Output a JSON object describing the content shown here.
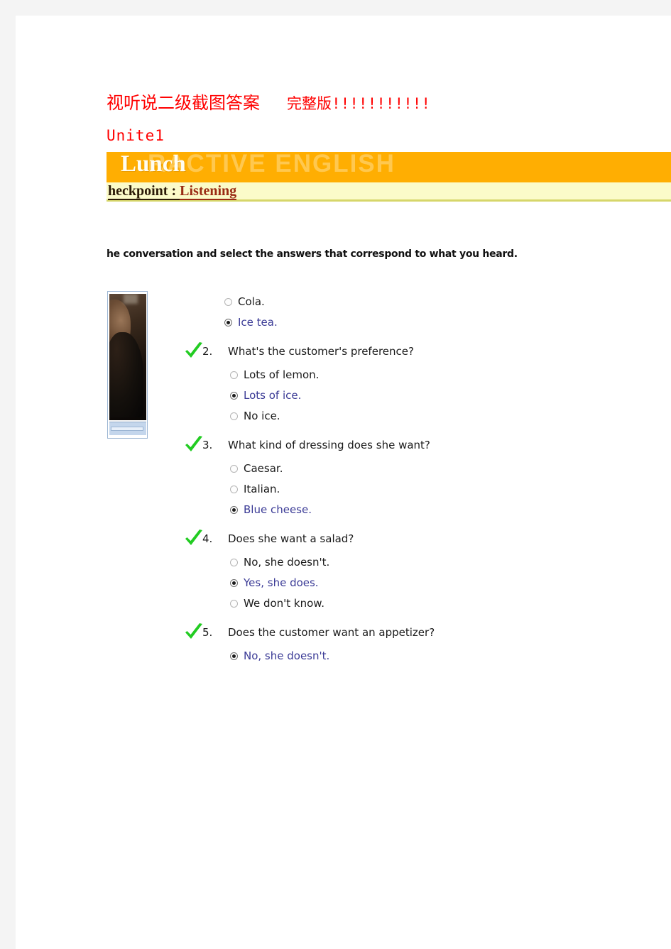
{
  "document": {
    "title_cn": "视听说二级截图答案",
    "title_bangs": "完整版!!!!!!!!!!!",
    "unit_label": "Unite1"
  },
  "screenshot": {
    "banner": {
      "title": "Lunch",
      "watermark": "RACTIVE ENGLISH",
      "bg_color": "#ffae02",
      "title_color": "#fffdf2"
    },
    "subbar": {
      "lead": "heckpoint",
      "separator": " : ",
      "accent": "Listening",
      "bg_color": "#fbfbc9",
      "accent_color": "#9a2b14"
    },
    "instructions": "he conversation and select the answers that correspond to what you heard.",
    "media": {
      "name": "video-thumbnail",
      "frame_color": "#9db6d4"
    }
  },
  "quiz": {
    "check_color": "#22cc22",
    "selected_color": "#3b3b96",
    "questions": [
      {
        "number": "",
        "text": "",
        "has_check": false,
        "indent": true,
        "options": [
          {
            "label": "Cola.",
            "selected": false
          },
          {
            "label": "Ice tea.",
            "selected": true
          }
        ]
      },
      {
        "number": "2.",
        "text": "What's the customer's preference?",
        "has_check": true,
        "indent": false,
        "options": [
          {
            "label": "Lots of lemon.",
            "selected": false
          },
          {
            "label": "Lots of ice.",
            "selected": true
          },
          {
            "label": "No ice.",
            "selected": false
          }
        ]
      },
      {
        "number": "3.",
        "text": "What kind of dressing does she want?",
        "has_check": true,
        "indent": false,
        "options": [
          {
            "label": "Caesar.",
            "selected": false
          },
          {
            "label": "Italian.",
            "selected": false
          },
          {
            "label": "Blue cheese.",
            "selected": true
          }
        ]
      },
      {
        "number": "4.",
        "text": "Does she want a salad?",
        "has_check": true,
        "indent": false,
        "options": [
          {
            "label": "No, she doesn't.",
            "selected": false
          },
          {
            "label": "Yes, she does.",
            "selected": true
          },
          {
            "label": "We don't know.",
            "selected": false
          }
        ]
      },
      {
        "number": "5.",
        "text": "Does the customer want an appetizer?",
        "has_check": true,
        "indent": false,
        "options": [
          {
            "label": "No, she doesn't.",
            "selected": true
          }
        ]
      }
    ]
  }
}
